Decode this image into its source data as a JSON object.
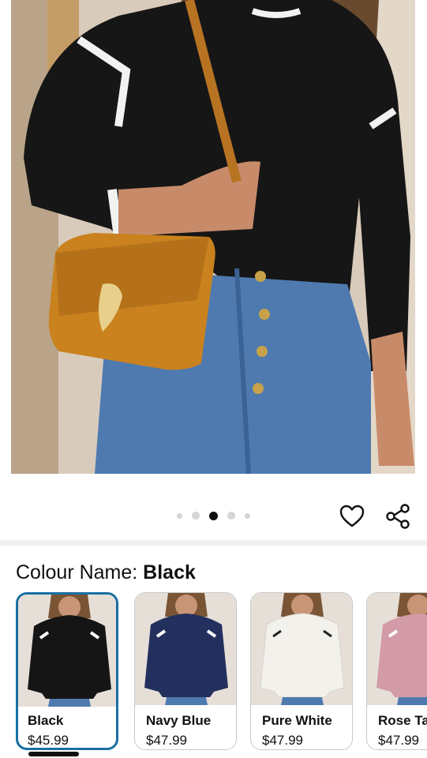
{
  "product_image": {
    "alt_icon": "product-photo"
  },
  "carousel": {
    "count": 5,
    "active_index": 2
  },
  "actions": {
    "favorite_icon": "heart-icon",
    "share_icon": "share-icon"
  },
  "colour": {
    "label": "Colour Name: ",
    "selected": "Black"
  },
  "swatches": [
    {
      "name": "Black",
      "price": "$45.99",
      "color": "#151515",
      "selected": true
    },
    {
      "name": "Navy Blue",
      "price": "$47.99",
      "color": "#23305e",
      "selected": false
    },
    {
      "name": "Pure White",
      "price": "$47.99",
      "color": "#f1efea",
      "selected": false
    },
    {
      "name": "Rose Taupe",
      "price": "$47.99",
      "color": "#d39aa7",
      "selected": false
    }
  ],
  "colors": {
    "accent": "#1a6fa3",
    "bag": "#c9821e",
    "denim": "#4f7ab0"
  }
}
